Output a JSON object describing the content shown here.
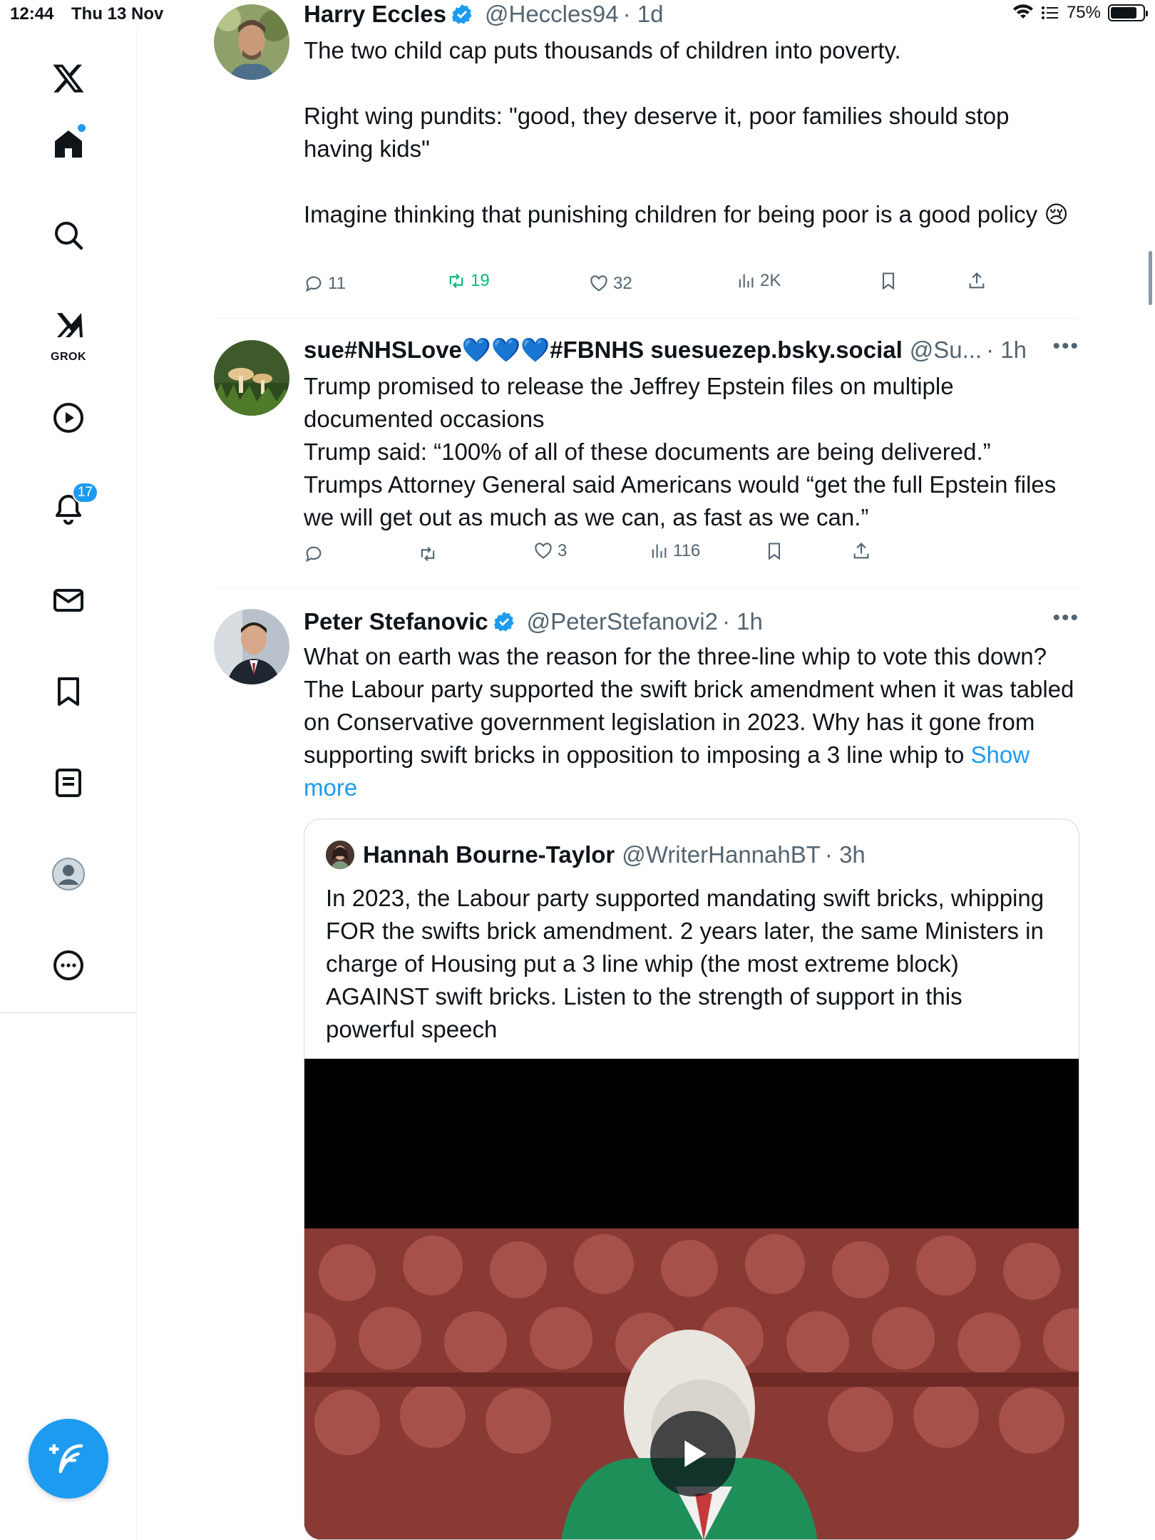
{
  "status_bar": {
    "time": "12:44",
    "date": "Thu 13 Nov",
    "battery": "75%"
  },
  "sidebar": {
    "notifications_badge": "17",
    "grok_label": "GROK",
    "items": [
      "x-logo",
      "home",
      "search",
      "grok",
      "video",
      "notifications",
      "messages",
      "bookmarks",
      "lists",
      "profile",
      "more"
    ]
  },
  "colors": {
    "accent": "#1d9bf0",
    "secondary_text": "#536471",
    "retweet_green": "#00ba7c",
    "border": "#eff3f4"
  },
  "tweets": [
    {
      "name": "Harry Eccles",
      "verified": true,
      "handle": "@Heccles94",
      "time": "· 1d",
      "body": "The two child cap puts thousands of children into poverty.\n\nRight wing pundits: \"good, they deserve it, poor families should stop having kids\"\n\nImagine thinking that punishing children for being poor is a good policy 😢",
      "replies": "11",
      "reposts": "19",
      "likes": "32",
      "views": "2K"
    },
    {
      "name": "sue#NHSLove💙💙💙#FBNHS suesuezep.bsky.social",
      "verified": false,
      "handle": "@Su...",
      "time": "· 1h",
      "body": "Trump promised to release the Jeffrey Epstein files on multiple documented occasions\nTrump said: “100% of all of these documents are being delivered.”\nTrumps Attorney General said Americans would “get the full Epstein files  we will get out as much as we can, as fast as we can.”",
      "replies": "",
      "reposts": "",
      "likes": "3",
      "views": "116"
    },
    {
      "name": "Peter Stefanovic",
      "verified": true,
      "handle": "@PeterStefanovi2",
      "time": "· 1h",
      "body": "What on earth was the reason for the three-line whip to vote this down? The Labour party supported the swift brick amendment when it was tabled on Conservative government legislation in 2023. Why has it gone from supporting swift bricks in opposition to imposing a 3 line whip to ",
      "show_more": "Show more",
      "quote": {
        "name": "Hannah Bourne-Taylor",
        "handle": "@WriterHannahBT",
        "time": "· 3h",
        "body": "In 2023, the Labour party supported mandating swift bricks, whipping FOR the swifts brick amendment. 2 years later, the same Ministers in charge of Housing put a 3 line whip (the most extreme block) AGAINST swift bricks. Listen to the strength of support in this powerful speech"
      }
    }
  ]
}
